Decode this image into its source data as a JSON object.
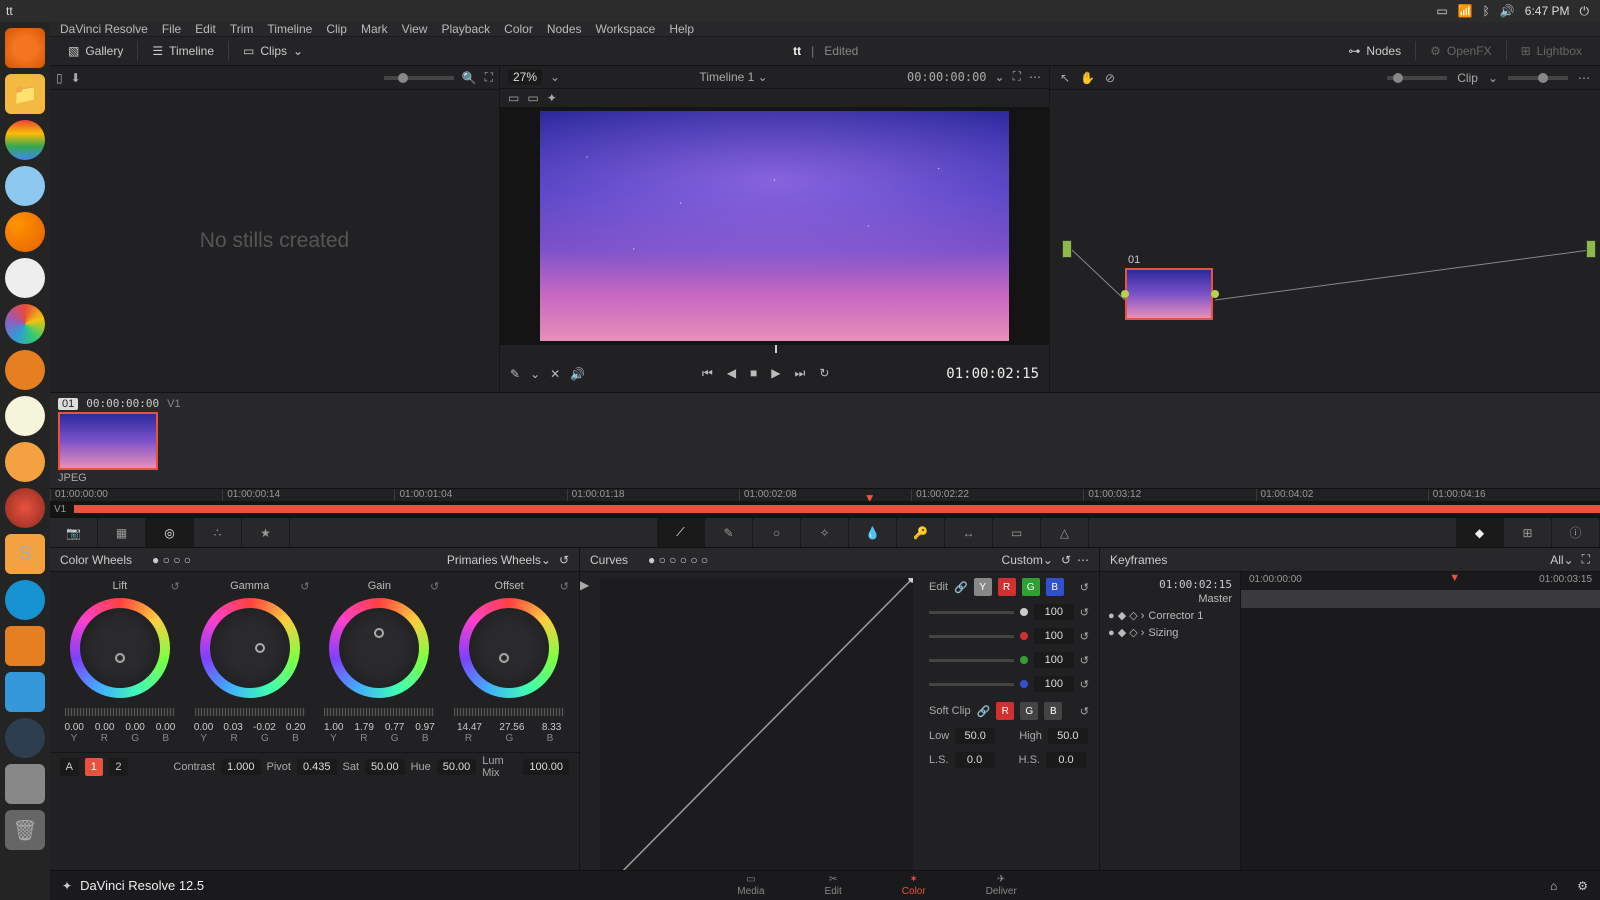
{
  "system": {
    "title": "tt",
    "time": "6:47 PM"
  },
  "menus": [
    "DaVinci Resolve",
    "File",
    "Edit",
    "Trim",
    "Timeline",
    "Clip",
    "Mark",
    "View",
    "Playback",
    "Color",
    "Nodes",
    "Workspace",
    "Help"
  ],
  "topbar": {
    "gallery": "Gallery",
    "timeline": "Timeline",
    "clips": "Clips",
    "project": "tt",
    "status": "Edited",
    "nodes": "Nodes",
    "openfx": "OpenFX",
    "lightbox": "Lightbox"
  },
  "viewer": {
    "zoom": "27%",
    "timeline": "Timeline 1",
    "tc_top": "00:00:00:00",
    "tc_play": "01:00:02:15"
  },
  "nodes": {
    "mode": "Clip",
    "node_id": "01"
  },
  "stills": {
    "empty": "No stills created"
  },
  "clip": {
    "num": "01",
    "tc": "00:00:00:00",
    "track": "V1",
    "format": "JPEG"
  },
  "timeline_ticks": [
    "01:00:00:00",
    "01:00:00:14",
    "01:00:01:04",
    "01:00:01:18",
    "01:00:02:08",
    "01:00:02:22",
    "01:00:03:12",
    "01:00:04:02",
    "01:00:04:16"
  ],
  "timeline_track": "V1",
  "wheels": {
    "title": "Color Wheels",
    "mode": "Primaries Wheels",
    "cols": [
      {
        "name": "Lift",
        "vals": [
          "0.00",
          "0.00",
          "0.00",
          "0.00"
        ]
      },
      {
        "name": "Gamma",
        "vals": [
          "0.00",
          "0.03",
          "-0.02",
          "0.20"
        ]
      },
      {
        "name": "Gain",
        "vals": [
          "1.00",
          "1.79",
          "0.77",
          "0.97"
        ]
      },
      {
        "name": "Offset",
        "vals": [
          "14.47",
          "27.56",
          "8.33",
          ""
        ]
      }
    ],
    "ch4": [
      "Y",
      "R",
      "G",
      "B"
    ],
    "ch3": [
      "R",
      "G",
      "B"
    ],
    "buttons": {
      "a": "A",
      "one": "1",
      "two": "2"
    },
    "globals": {
      "contrast_l": "Contrast",
      "contrast": "1.000",
      "pivot_l": "Pivot",
      "pivot": "0.435",
      "sat_l": "Sat",
      "sat": "50.00",
      "hue_l": "Hue",
      "hue": "50.00",
      "lummix_l": "Lum Mix",
      "lummix": "100.00"
    }
  },
  "curves": {
    "title": "Curves",
    "mode": "Custom",
    "edit_l": "Edit",
    "soft_l": "Soft Clip",
    "ch_vals": [
      "100",
      "100",
      "100",
      "100"
    ],
    "low_l": "Low",
    "low": "50.0",
    "high_l": "High",
    "high": "50.0",
    "ls_l": "L.S.",
    "ls": "0.0",
    "hs_l": "H.S.",
    "hs": "0.0"
  },
  "kf": {
    "title": "Keyframes",
    "mode": "All",
    "tc": "01:00:02:15",
    "lanes_tc": [
      "01:00:00:00",
      "01:00:03:15"
    ],
    "master": "Master",
    "items": [
      "Corrector 1",
      "Sizing"
    ]
  },
  "footer": {
    "app": "DaVinci Resolve 12.5",
    "pages": [
      "Media",
      "Edit",
      "Color",
      "Deliver"
    ]
  }
}
